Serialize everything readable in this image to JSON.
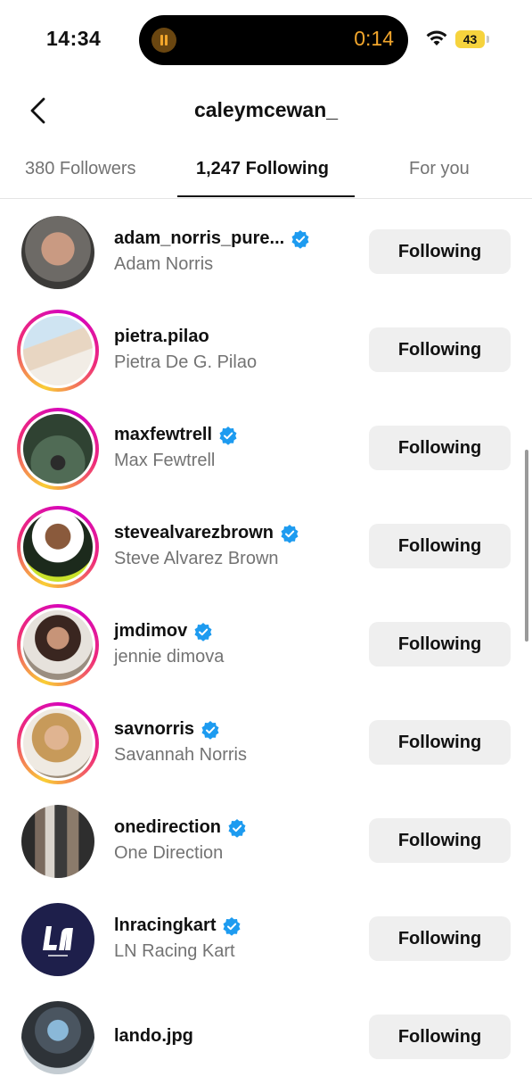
{
  "status_bar": {
    "time": "14:34",
    "timer": "0:14",
    "battery": "43"
  },
  "header": {
    "title": "caleymcewan_"
  },
  "tabs": [
    {
      "label": "380 Followers"
    },
    {
      "label": "1,247 Following"
    },
    {
      "label": "For you"
    }
  ],
  "colors": {
    "verified": "#1d9bf0",
    "button_bg": "#efefef",
    "secondary_text": "#737373",
    "timer": "#f2a62c"
  },
  "rows": [
    {
      "username": "adam_norris_pure...",
      "name": "Adam Norris",
      "verified": true,
      "button": "Following",
      "story": false
    },
    {
      "username": "pietra.pilao",
      "name": "Pietra De G. Pilao",
      "verified": false,
      "button": "Following",
      "story": true
    },
    {
      "username": "maxfewtrell",
      "name": "Max Fewtrell",
      "verified": true,
      "button": "Following",
      "story": true
    },
    {
      "username": "stevealvarezbrown",
      "name": "Steve Alvarez Brown",
      "verified": true,
      "button": "Following",
      "story": true
    },
    {
      "username": "jmdimov",
      "name": "jennie dimova",
      "verified": true,
      "button": "Following",
      "story": true
    },
    {
      "username": "savnorris",
      "name": "Savannah Norris",
      "verified": true,
      "button": "Following",
      "story": true
    },
    {
      "username": "onedirection",
      "name": "One Direction",
      "verified": true,
      "button": "Following",
      "story": false
    },
    {
      "username": "lnracingkart",
      "name": "LN Racing Kart",
      "verified": true,
      "button": "Following",
      "story": false
    },
    {
      "username": "lando.jpg",
      "name": "",
      "verified": false,
      "button": "Following",
      "story": false
    }
  ]
}
